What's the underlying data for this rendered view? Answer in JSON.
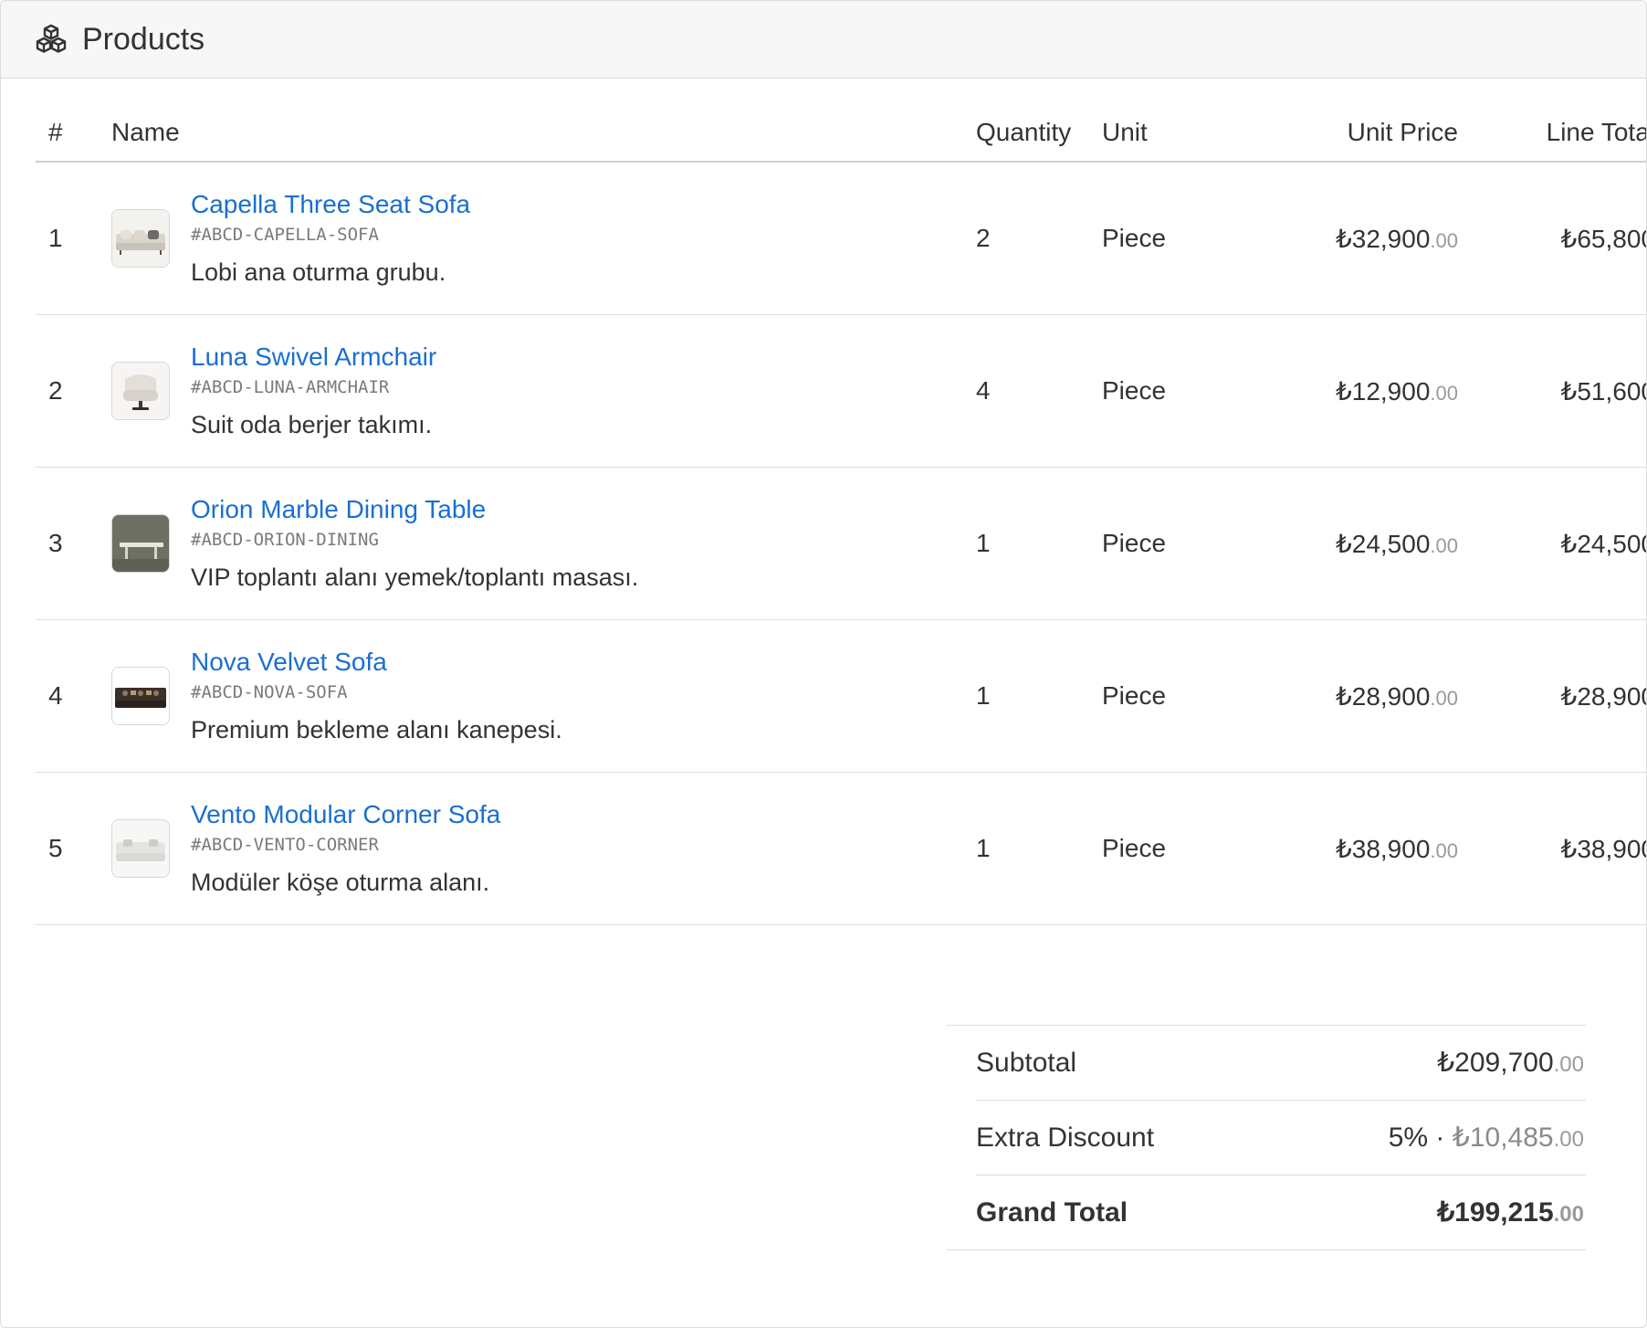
{
  "header": {
    "title": "Products",
    "icon": "boxes-icon"
  },
  "table": {
    "columns": [
      "#",
      "Name",
      "Quantity",
      "Unit",
      "Unit Price",
      "Line Total"
    ],
    "rows": [
      {
        "num": "1",
        "name": "Capella Three Seat Sofa",
        "sku": "#ABCD-CAPELLA-SOFA",
        "desc": "Lobi ana oturma grubu.",
        "qty": "2",
        "unit": "Piece",
        "price_main": "₺32,900",
        "price_cents": ".00",
        "total": "₺65,800",
        "thumb": "sofa-light"
      },
      {
        "num": "2",
        "name": "Luna Swivel Armchair",
        "sku": "#ABCD-LUNA-ARMCHAIR",
        "desc": "Suit oda berjer takımı.",
        "qty": "4",
        "unit": "Piece",
        "price_main": "₺12,900",
        "price_cents": ".00",
        "total": "₺51,600",
        "thumb": "armchair"
      },
      {
        "num": "3",
        "name": "Orion Marble Dining Table",
        "sku": "#ABCD-ORION-DINING",
        "desc": "VIP toplantı alanı yemek/toplantı masası.",
        "qty": "1",
        "unit": "Piece",
        "price_main": "₺24,500",
        "price_cents": ".00",
        "total": "₺24,500",
        "thumb": "table"
      },
      {
        "num": "4",
        "name": "Nova Velvet Sofa",
        "sku": "#ABCD-NOVA-SOFA",
        "desc": "Premium bekleme alanı kanepesi.",
        "qty": "1",
        "unit": "Piece",
        "price_main": "₺28,900",
        "price_cents": ".00",
        "total": "₺28,900",
        "thumb": "sofa-dark"
      },
      {
        "num": "5",
        "name": "Vento Modular Corner Sofa",
        "sku": "#ABCD-VENTO-CORNER",
        "desc": "Modüler köşe oturma alanı.",
        "qty": "1",
        "unit": "Piece",
        "price_main": "₺38,900",
        "price_cents": ".00",
        "total": "₺38,900",
        "thumb": "sofa-white"
      }
    ]
  },
  "summary": {
    "subtotal_label": "Subtotal",
    "subtotal_main": "₺209,700",
    "subtotal_cents": ".00",
    "discount_label": "Extra Discount",
    "discount_percent": "5%",
    "discount_sep": " · ",
    "discount_main": "₺10,485",
    "discount_cents": ".00",
    "grand_label": "Grand Total",
    "grand_main": "₺199,215",
    "grand_cents": ".00"
  },
  "colors": {
    "link": "#1a6fd0",
    "muted": "#9a9a9a",
    "header_bg": "#f7f7f7"
  }
}
